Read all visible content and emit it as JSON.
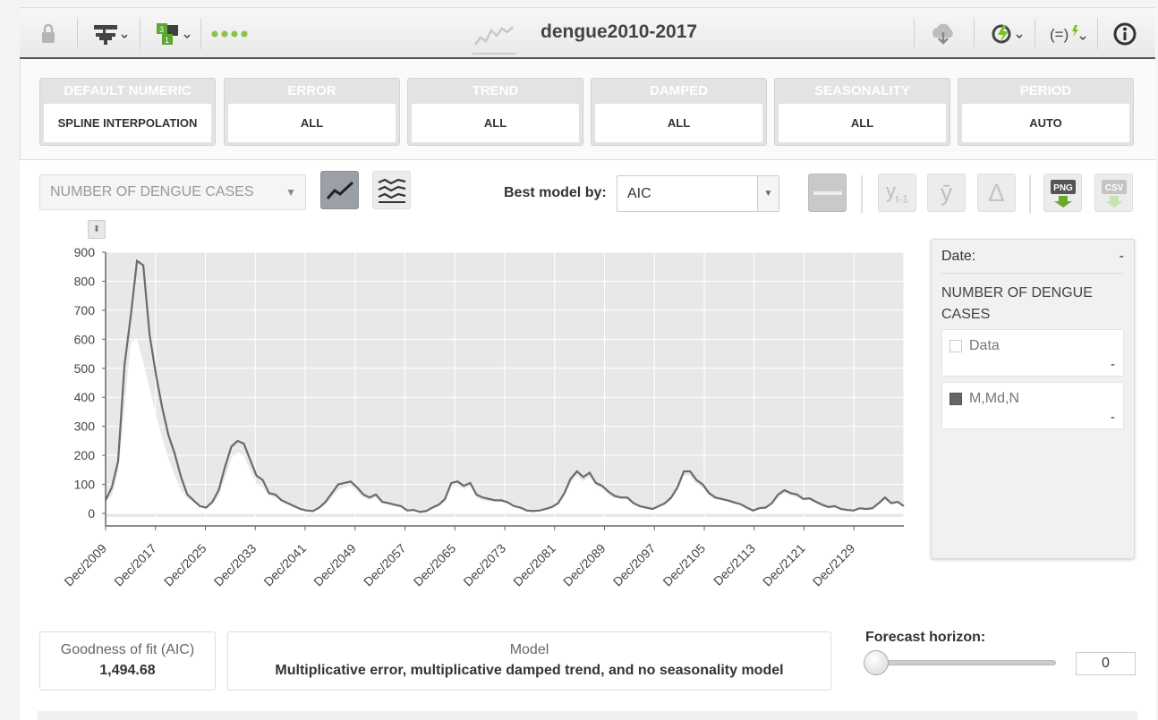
{
  "toolbar": {
    "title": "dengue2010-2017",
    "icons": [
      "lock-icon",
      "tree-icon",
      "dataset-icon",
      "progress-dots-icon",
      "series-icon",
      "download-icon",
      "refresh-icon",
      "formula-icon",
      "info-icon"
    ]
  },
  "cards": [
    {
      "header": "DEFAULT NUMERIC",
      "value": "SPLINE INTERPOLATION"
    },
    {
      "header": "ERROR",
      "value": "ALL"
    },
    {
      "header": "TREND",
      "value": "ALL"
    },
    {
      "header": "DAMPED",
      "value": "ALL"
    },
    {
      "header": "SEASONALITY",
      "value": "ALL"
    },
    {
      "header": "PERIOD",
      "value": "AUTO"
    }
  ],
  "field_select": {
    "value": "NUMBER OF DENGUE CASES"
  },
  "best_model": {
    "label": "Best model by:",
    "value": "AIC"
  },
  "tools": {
    "lag_label": "y",
    "lag_sub": "t-1",
    "mean_label": "ȳ",
    "delta_label": "Δ",
    "png_label": "PNG",
    "csv_label": "CSV"
  },
  "legend": {
    "date_label": "Date:",
    "date_value": "-",
    "field_name": "NUMBER OF DENGUE CASES",
    "entries": [
      {
        "name": "Data",
        "value": "-"
      },
      {
        "name": "M,Md,N",
        "value": "-"
      }
    ]
  },
  "fit": {
    "label": "Goodness of fit (AIC)",
    "value": "1,494.68"
  },
  "model": {
    "label": "Model",
    "value": "Multiplicative error, multiplicative damped trend, and no seasonality model"
  },
  "forecast": {
    "label": "Forecast horizon:",
    "value": "0"
  },
  "colors": {
    "accent": "#7c7c7c",
    "card_header": "#e3e3e3",
    "green": "#7cc12a"
  },
  "chart_data": {
    "type": "line",
    "xlabel": "",
    "ylabel": "",
    "ylim": [
      0,
      900
    ],
    "yticks": [
      0,
      100,
      200,
      300,
      400,
      500,
      600,
      700,
      800,
      900
    ],
    "xticks": [
      "Dec/2009",
      "Dec/2017",
      "Dec/2025",
      "Dec/2033",
      "Dec/2041",
      "Dec/2049",
      "Dec/2057",
      "Dec/2065",
      "Dec/2073",
      "Dec/2081",
      "Dec/2089",
      "Dec/2097",
      "Dec/2105",
      "Dec/2113",
      "Dec/2121",
      "Dec/2129"
    ],
    "x_start": 0,
    "x_end": 127,
    "grid": true,
    "series": [
      {
        "name": "M,Md,N",
        "values": [
          45,
          90,
          180,
          510,
          680,
          870,
          855,
          615,
          480,
          365,
          270,
          205,
          125,
          65,
          45,
          25,
          20,
          40,
          80,
          160,
          230,
          250,
          240,
          185,
          130,
          115,
          70,
          65,
          45,
          35,
          25,
          15,
          10,
          8,
          20,
          40,
          70,
          100,
          105,
          110,
          90,
          65,
          55,
          65,
          40,
          35,
          30,
          25,
          10,
          12,
          5,
          8,
          20,
          30,
          50,
          105,
          110,
          95,
          105,
          65,
          55,
          50,
          45,
          45,
          38,
          25,
          20,
          10,
          8,
          10,
          15,
          22,
          35,
          70,
          120,
          145,
          125,
          140,
          105,
          95,
          75,
          60,
          55,
          55,
          35,
          25,
          20,
          15,
          25,
          35,
          55,
          90,
          145,
          145,
          115,
          100,
          70,
          55,
          50,
          45,
          38,
          32,
          20,
          10,
          18,
          20,
          35,
          65,
          80,
          70,
          65,
          50,
          52,
          40,
          30,
          22,
          25,
          15,
          12,
          10,
          18,
          15,
          18,
          35,
          55,
          35,
          40,
          25
        ]
      },
      {
        "name": "Data",
        "values": [
          45,
          60,
          140,
          360,
          590,
          600,
          520,
          430,
          340,
          260,
          190,
          130,
          80,
          50,
          40,
          25,
          20,
          30,
          60,
          120,
          190,
          210,
          200,
          150,
          100,
          90,
          60,
          55,
          40,
          30,
          20,
          12,
          8,
          6,
          15,
          30,
          55,
          80,
          90,
          95,
          75,
          55,
          45,
          55,
          35,
          30,
          25,
          20,
          8,
          10,
          4,
          6,
          15,
          25,
          40,
          90,
          95,
          85,
          95,
          55,
          45,
          42,
          40,
          40,
          32,
          22,
          18,
          8,
          6,
          8,
          12,
          18,
          30,
          60,
          105,
          130,
          110,
          125,
          95,
          85,
          65,
          52,
          48,
          48,
          30,
          22,
          18,
          12,
          20,
          30,
          48,
          80,
          130,
          130,
          100,
          88,
          62,
          48,
          45,
          40,
          32,
          28,
          18,
          8,
          15,
          18,
          30,
          55,
          70,
          62,
          55,
          45,
          45,
          35,
          25,
          18,
          20,
          12,
          10,
          8,
          15,
          12,
          15,
          30,
          45,
          30,
          35,
          22
        ]
      }
    ]
  }
}
